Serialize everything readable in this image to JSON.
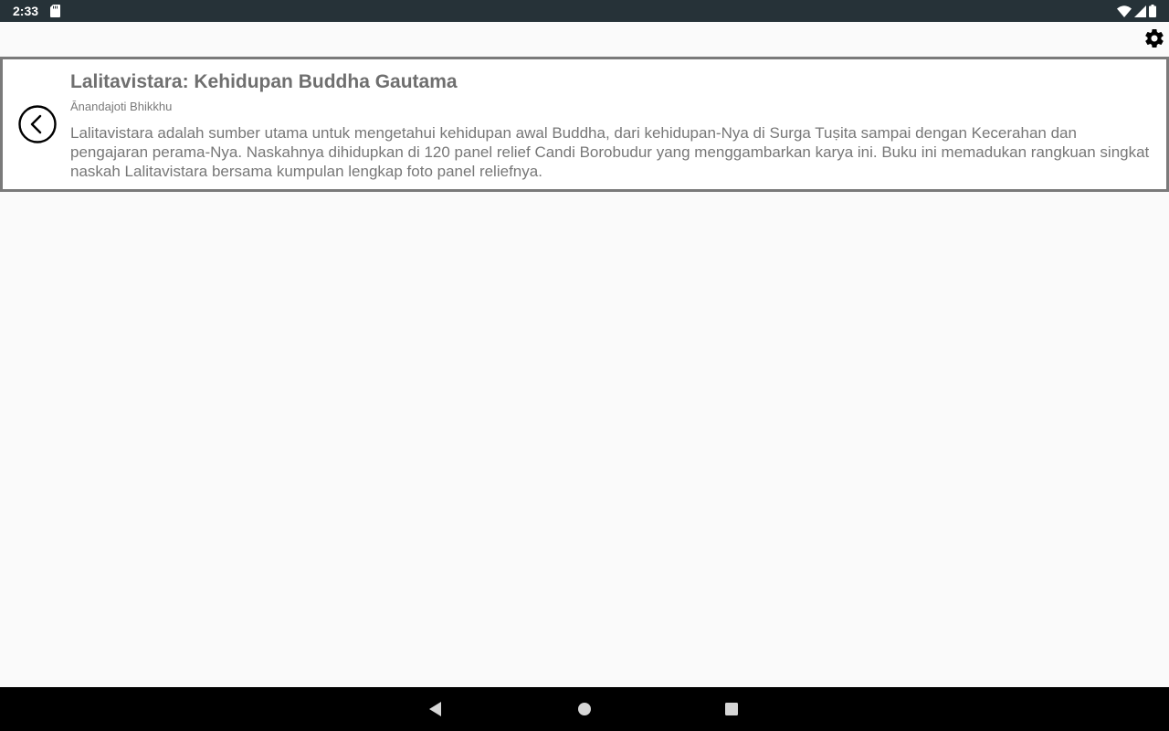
{
  "status_bar": {
    "time": "2:33",
    "icons": [
      "sd-card-icon",
      "wifi-icon",
      "cellular-signal-icon",
      "battery-icon"
    ]
  },
  "toolbar": {
    "settings_icon": "gear-icon"
  },
  "book": {
    "title": "Lalitavistara: Kehidupan Buddha Gautama",
    "author": "Ānandajoti Bhikkhu",
    "description": "Lalitavistara adalah sumber utama untuk mengetahui kehidupan awal Buddha, dari kehidupan-Nya di Surga Tuṣita sampai dengan Kecerahan dan pengajaran perama-Nya. Naskahnya dihidupkan di 120 panel relief Candi Borobudur yang menggambarkan karya ini. Buku ini memadukan rangkuan singkat naskah Lalitavistara bersama kumpulan lengkap foto panel reliefnya.",
    "back_icon": "circle-chevron-left-icon"
  },
  "nav_bar": {
    "icons": [
      "back-triangle-icon",
      "home-circle-icon",
      "recents-square-icon"
    ]
  },
  "colors": {
    "status_bar_bg": "#263238",
    "app_bg": "#fafafa",
    "card_border": "#7a7a7a",
    "text": "#757575",
    "nav_bar_bg": "#000000"
  }
}
